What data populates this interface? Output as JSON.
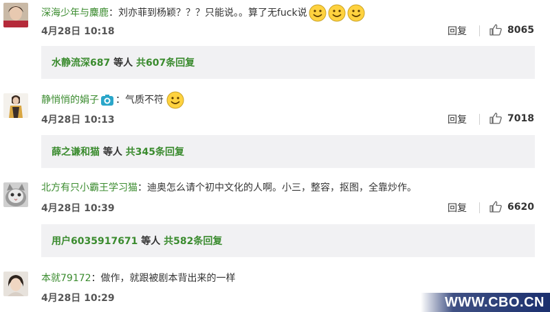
{
  "comments": [
    {
      "username": "深海少年与麋鹿",
      "colon": "：",
      "text": "刘亦菲到杨颖？？？只能说。。算了无fuck说",
      "time": "4月28日 10:18",
      "reply_label": "回复",
      "likes": "8065",
      "reply_summary": {
        "users": "水静流深687",
        "middle": " 等人 ",
        "link": "共607条回复"
      }
    },
    {
      "username": "静悄悄的娟子",
      "colon": "：",
      "text": "气质不符",
      "time": "4月28日 10:13",
      "reply_label": "回复",
      "likes": "7018",
      "reply_summary": {
        "users": "薛之谦和猫",
        "middle": " 等人 ",
        "link": "共345条回复"
      }
    },
    {
      "username": "北方有只小霸王学习猫",
      "colon": "：",
      "text": "迪奥怎么请个初中文化的人啊。小三，整容，抠图，全靠炒作。",
      "time": "4月28日 10:39",
      "reply_label": "回复",
      "likes": "6620",
      "reply_summary": {
        "users": "用户6035917671",
        "middle": " 等人 ",
        "link": "共582条回复"
      }
    },
    {
      "username": "本就79172",
      "colon": "：",
      "text": "做作，就跟被剧本背出来的一样",
      "time": "4月28日 10:29"
    }
  ],
  "watermark": "WWW.CBO.CN",
  "colors": {
    "username": "#3a8b2e",
    "reply_box_bg": "#f1f1f3",
    "watermark_bg": "#1a2f6e"
  },
  "icons": [
    "smiley-emoji-icon",
    "camera-badge-icon",
    "thumbs-up-icon"
  ]
}
